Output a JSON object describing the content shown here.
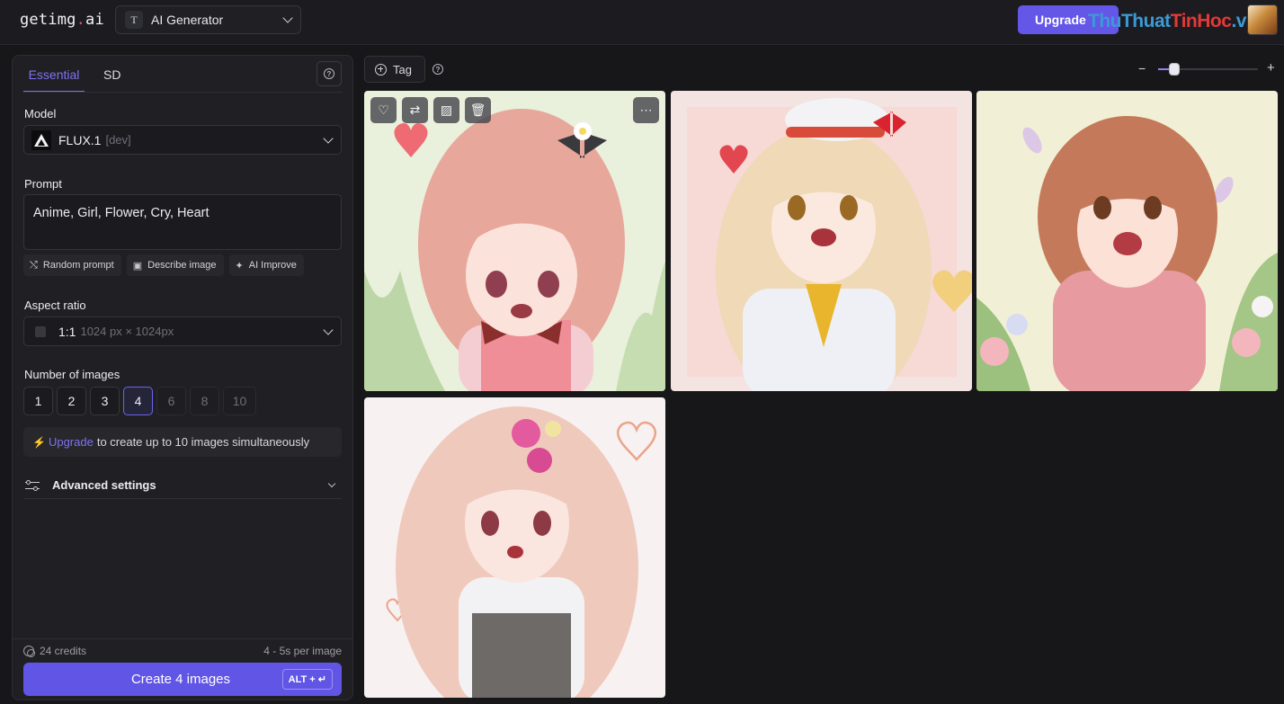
{
  "topbar": {
    "logo_main": "getimg",
    "logo_dot": ".",
    "logo_tail": "ai",
    "tool_icon": "T",
    "tool_label": "AI Generator",
    "upgrade_label": "Upgrade",
    "watermark_part1": "ThuThuat",
    "watermark_part2": "TinHoc",
    "watermark_part3": ".vn"
  },
  "panel": {
    "tabs": [
      {
        "label": "Essential",
        "active": true
      },
      {
        "label": "SD",
        "active": false
      }
    ],
    "model": {
      "label": "Model",
      "name": "FLUX.1",
      "variant": "[dev]"
    },
    "prompt": {
      "label": "Prompt",
      "value": "Anime, Girl, Flower, Cry, Heart",
      "actions": [
        {
          "label": "Random prompt",
          "icon": "shuffle-icon"
        },
        {
          "label": "Describe image",
          "icon": "image-icon"
        },
        {
          "label": "AI Improve",
          "icon": "sparkle-icon"
        }
      ]
    },
    "aspect_ratio": {
      "label": "Aspect ratio",
      "ratio": "1:1",
      "size": "1024 px × 1024px"
    },
    "number_of_images": {
      "label": "Number of images",
      "options": [
        "1",
        "2",
        "3",
        "4",
        "6",
        "8",
        "10"
      ],
      "selected": "4"
    },
    "upgrade_note": {
      "link": "Upgrade",
      "text": "to create up to 10 images simultaneously"
    },
    "advanced_label": "Advanced settings",
    "credits": "24 credits",
    "time_per_image": "4 - 5s per image",
    "create_label": "Create 4 images",
    "shortcut_label": "ALT + ↵"
  },
  "main": {
    "tag_label": "Tag",
    "zoom_minus": "−",
    "zoom_plus": "+",
    "zoom_level": 0.16,
    "images": [
      {
        "name": "image-pink-hair-black-bow",
        "hair": "#e8a79b",
        "bg": "#e9f0dc"
      },
      {
        "name": "image-blonde-sailor-hat",
        "hair": "#efd9b6",
        "bg": "#f3e3e1"
      },
      {
        "name": "image-brown-bob-flowers",
        "hair": "#c4795b",
        "bg": "#f1f0d6"
      },
      {
        "name": "image-long-pink-hair-hearts",
        "hair": "#f0c9bd",
        "bg": "#f7f2f1"
      }
    ]
  },
  "colors": {
    "accent": "#6457e8",
    "bg": "#17171a",
    "panel": "#202024"
  }
}
